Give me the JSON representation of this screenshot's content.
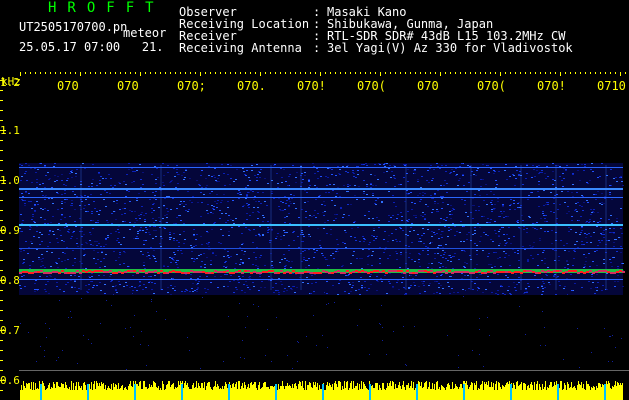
{
  "header": {
    "app_title": "HROFFT",
    "file_name": "UT2505170700.pn",
    "tag": "meteor",
    "date_time": "25.05.17 07:00",
    "frame_number": "21.",
    "info_rows": [
      {
        "label": "Observer",
        "value": "Masaki Kano"
      },
      {
        "label": "Receiving Location",
        "value": "Shibukawa, Gunma, Japan"
      },
      {
        "label": "Receiver",
        "value": "RTL-SDR SDR# 43dB L15 103.2MHz CW"
      },
      {
        "label": "Receiving Antenna",
        "value": "3el Yagi(V) Az 330 for Vladivostok"
      }
    ],
    "colon": ":"
  },
  "axis": {
    "unit": "kHz",
    "time_labels": [
      "070",
      "070",
      "070;",
      "070.",
      "070!",
      "070(",
      "070",
      "070(",
      "070!",
      "0710"
    ],
    "freq_labels": [
      "1.2",
      "1.1",
      "1.0",
      "0.9",
      "0.8",
      "0.7",
      "0.6"
    ]
  },
  "colors": {
    "background": "#000000",
    "title_green": "#00ff00",
    "axis_yellow": "#ffff00",
    "signal_blue": "#1030c0",
    "echo_red": "#ff2020",
    "level_yellow": "#ffff00"
  }
}
